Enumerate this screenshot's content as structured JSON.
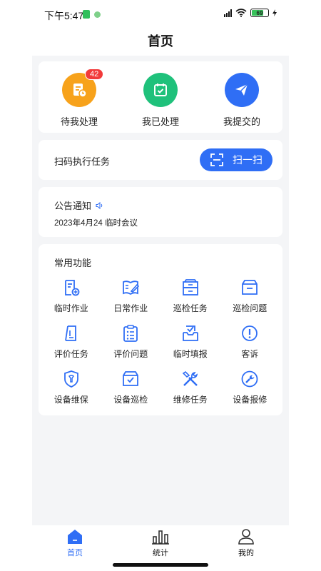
{
  "status_bar": {
    "time": "下午5:47",
    "battery": "69"
  },
  "header": {
    "title": "首页"
  },
  "stats": [
    {
      "label": "待我处理",
      "badge": "42",
      "icon": "doc-clock-icon",
      "color": "#f7a21b"
    },
    {
      "label": "我已处理",
      "icon": "calendar-check-icon",
      "color": "#1fc17b"
    },
    {
      "label": "我提交的",
      "icon": "paper-plane-icon",
      "color": "#2f6ef5"
    }
  ],
  "scan": {
    "label": "扫码执行任务",
    "button": "扫一扫"
  },
  "notice": {
    "title": "公告通知",
    "text": "2023年4月24 临时会议"
  },
  "functions": {
    "title": "常用功能",
    "items": [
      {
        "label": "临时作业",
        "icon": "temp-work-icon"
      },
      {
        "label": "日常作业",
        "icon": "daily-work-icon"
      },
      {
        "label": "巡检任务",
        "icon": "inspection-task-icon"
      },
      {
        "label": "巡检问题",
        "icon": "inspection-issue-icon"
      },
      {
        "label": "评价任务",
        "icon": "evaluate-task-icon"
      },
      {
        "label": "评价问题",
        "icon": "evaluate-issue-icon"
      },
      {
        "label": "临时填报",
        "icon": "temp-report-icon"
      },
      {
        "label": "客诉",
        "icon": "complaint-icon"
      },
      {
        "label": "设备维保",
        "icon": "device-maintenance-icon"
      },
      {
        "label": "设备巡检",
        "icon": "device-inspection-icon"
      },
      {
        "label": "维修任务",
        "icon": "repair-task-icon"
      },
      {
        "label": "设备报修",
        "icon": "device-repair-report-icon"
      }
    ]
  },
  "nav": [
    {
      "label": "首页",
      "icon": "home-icon",
      "active": true
    },
    {
      "label": "统计",
      "icon": "stats-icon"
    },
    {
      "label": "我的",
      "icon": "profile-icon"
    }
  ],
  "accent_color": "#2f6ef5"
}
